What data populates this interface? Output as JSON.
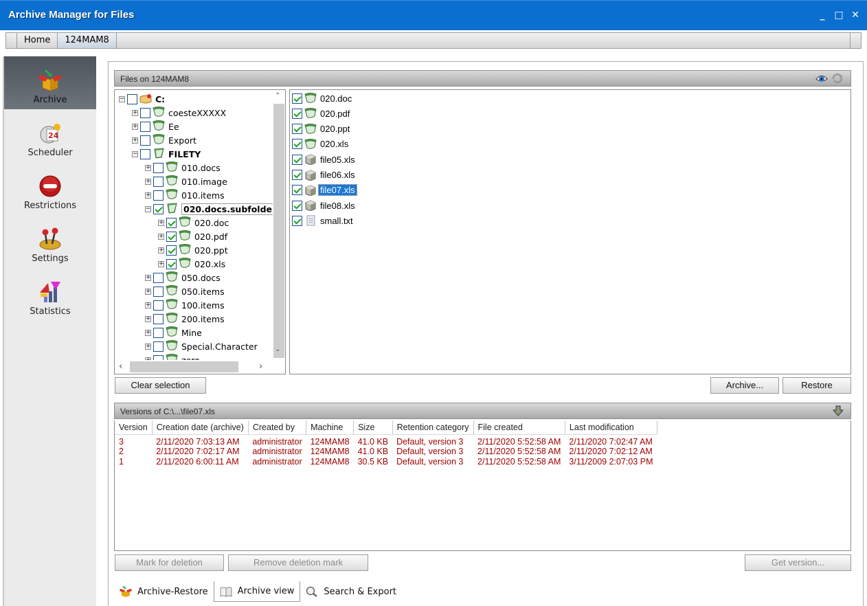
{
  "window": {
    "title": "Archive Manager for Files",
    "controls": {
      "minimize": "_",
      "maximize": "□",
      "close": "✕"
    }
  },
  "breadcrumbs": [
    {
      "label": "Home",
      "active": false
    },
    {
      "label": "124MAM8",
      "active": true
    }
  ],
  "sidebar": {
    "items": [
      {
        "label": "Archive",
        "icon": "archive-box-icon",
        "active": true
      },
      {
        "label": "Scheduler",
        "icon": "scheduler-clock-icon",
        "active": false
      },
      {
        "label": "Restrictions",
        "icon": "restrictions-no-entry-icon",
        "active": false
      },
      {
        "label": "Settings",
        "icon": "settings-joystick-icon",
        "active": false
      },
      {
        "label": "Statistics",
        "icon": "statistics-chart-icon",
        "active": false
      }
    ]
  },
  "files_panel": {
    "title": "Files on 124MAM8",
    "header_icons": [
      "view-eye-icon",
      "refresh-icon"
    ]
  },
  "tree": {
    "nodes": [
      {
        "label": "C:",
        "level": 0,
        "expander": "-",
        "checked": false,
        "icon": "drive-icon",
        "bold": true
      },
      {
        "label": "coesteXXXXX",
        "level": 1,
        "expander": "+",
        "checked": false,
        "icon": "folder-icon"
      },
      {
        "label": "Ee",
        "level": 1,
        "expander": "+",
        "checked": false,
        "icon": "folder-icon"
      },
      {
        "label": "Export",
        "level": 1,
        "expander": "+",
        "checked": false,
        "icon": "folder-icon"
      },
      {
        "label": "FILETY",
        "level": 1,
        "expander": "-",
        "checked": false,
        "icon": "folder-open-icon",
        "bold": true
      },
      {
        "label": "010.docs",
        "level": 2,
        "expander": "+",
        "checked": false,
        "icon": "folder-icon"
      },
      {
        "label": "010.image",
        "level": 2,
        "expander": "+",
        "checked": false,
        "icon": "folder-icon"
      },
      {
        "label": "010.items",
        "level": 2,
        "expander": "+",
        "checked": false,
        "icon": "folder-icon"
      },
      {
        "label": "020.docs.subfolde",
        "level": 2,
        "expander": "-",
        "checked": true,
        "icon": "folder-open-icon",
        "bold": true,
        "selected": true
      },
      {
        "label": "020.doc",
        "level": 3,
        "expander": "+",
        "checked": true,
        "icon": "folder-icon"
      },
      {
        "label": "020.pdf",
        "level": 3,
        "expander": "+",
        "checked": true,
        "icon": "folder-icon"
      },
      {
        "label": "020.ppt",
        "level": 3,
        "expander": "+",
        "checked": true,
        "icon": "folder-icon"
      },
      {
        "label": "020.xls",
        "level": 3,
        "expander": "+",
        "checked": true,
        "icon": "folder-icon"
      },
      {
        "label": "050.docs",
        "level": 2,
        "expander": "+",
        "checked": false,
        "icon": "folder-icon"
      },
      {
        "label": "050.items",
        "level": 2,
        "expander": "+",
        "checked": false,
        "icon": "folder-icon"
      },
      {
        "label": "100.items",
        "level": 2,
        "expander": "+",
        "checked": false,
        "icon": "folder-icon"
      },
      {
        "label": "200.items",
        "level": 2,
        "expander": "+",
        "checked": false,
        "icon": "folder-icon"
      },
      {
        "label": "Mine",
        "level": 2,
        "expander": "+",
        "checked": false,
        "icon": "folder-icon"
      },
      {
        "label": "Special.Character",
        "level": 2,
        "expander": "+",
        "checked": false,
        "icon": "folder-icon"
      },
      {
        "label": "zero",
        "level": 2,
        "expander": "+",
        "checked": false,
        "icon": "folder-icon"
      }
    ]
  },
  "file_list": {
    "items": [
      {
        "name": "020.doc",
        "checked": true,
        "icon": "folder-icon",
        "selected": false
      },
      {
        "name": "020.pdf",
        "checked": true,
        "icon": "folder-icon",
        "selected": false
      },
      {
        "name": "020.ppt",
        "checked": true,
        "icon": "folder-icon",
        "selected": false
      },
      {
        "name": "020.xls",
        "checked": true,
        "icon": "folder-icon",
        "selected": false
      },
      {
        "name": "file05.xls",
        "checked": true,
        "icon": "archived-file-icon",
        "selected": false
      },
      {
        "name": "file06.xls",
        "checked": true,
        "icon": "archived-file-icon",
        "selected": false
      },
      {
        "name": "file07.xls",
        "checked": true,
        "icon": "archived-file-icon",
        "selected": true
      },
      {
        "name": "file08.xls",
        "checked": true,
        "icon": "archived-file-icon",
        "selected": false
      },
      {
        "name": "small.txt",
        "checked": true,
        "icon": "text-file-icon",
        "selected": false
      }
    ]
  },
  "actions": {
    "clear_selection": "Clear selection",
    "archive": "Archive...",
    "restore": "Restore"
  },
  "versions_panel": {
    "title": "Versions of C:\\...\\file07.xls",
    "header_icon": "download-arrow-icon",
    "columns": [
      "Version",
      "Creation date (archive)",
      "Created by",
      "Machine",
      "Size",
      "Retention category",
      "File created",
      "Last modification"
    ],
    "rows": [
      [
        "3",
        "2/11/2020 7:03:13 AM",
        "administrator",
        "124MAM8",
        "41.0 KB",
        "Default, version 3",
        "2/11/2020 5:52:58 AM",
        "2/11/2020 7:02:47 AM"
      ],
      [
        "2",
        "2/11/2020 7:02:17 AM",
        "administrator",
        "124MAM8",
        "41.0 KB",
        "Default, version 3",
        "2/11/2020 5:52:58 AM",
        "2/11/2020 7:02:12 AM"
      ],
      [
        "1",
        "2/11/2020 6:00:11 AM",
        "administrator",
        "124MAM8",
        "30.5 KB",
        "Default, version 3",
        "2/11/2020 5:52:58 AM",
        "3/11/2009 2:07:03 PM"
      ]
    ],
    "row_text_color": "#a00000"
  },
  "version_actions": {
    "mark_for_deletion": "Mark for deletion",
    "remove_deletion_mark": "Remove deletion mark",
    "get_version": "Get version..."
  },
  "bottom_tabs": [
    {
      "label": "Archive-Restore",
      "icon": "archive-box-icon",
      "active": true
    },
    {
      "label": "Archive view",
      "icon": "book-icon",
      "active": false
    },
    {
      "label": "Search & Export",
      "icon": "magnifier-icon",
      "active": false
    }
  ],
  "colors": {
    "titlebar": "#0a6fcf",
    "selection": "#1a78d6",
    "sidebar_active": "#5a6068"
  }
}
